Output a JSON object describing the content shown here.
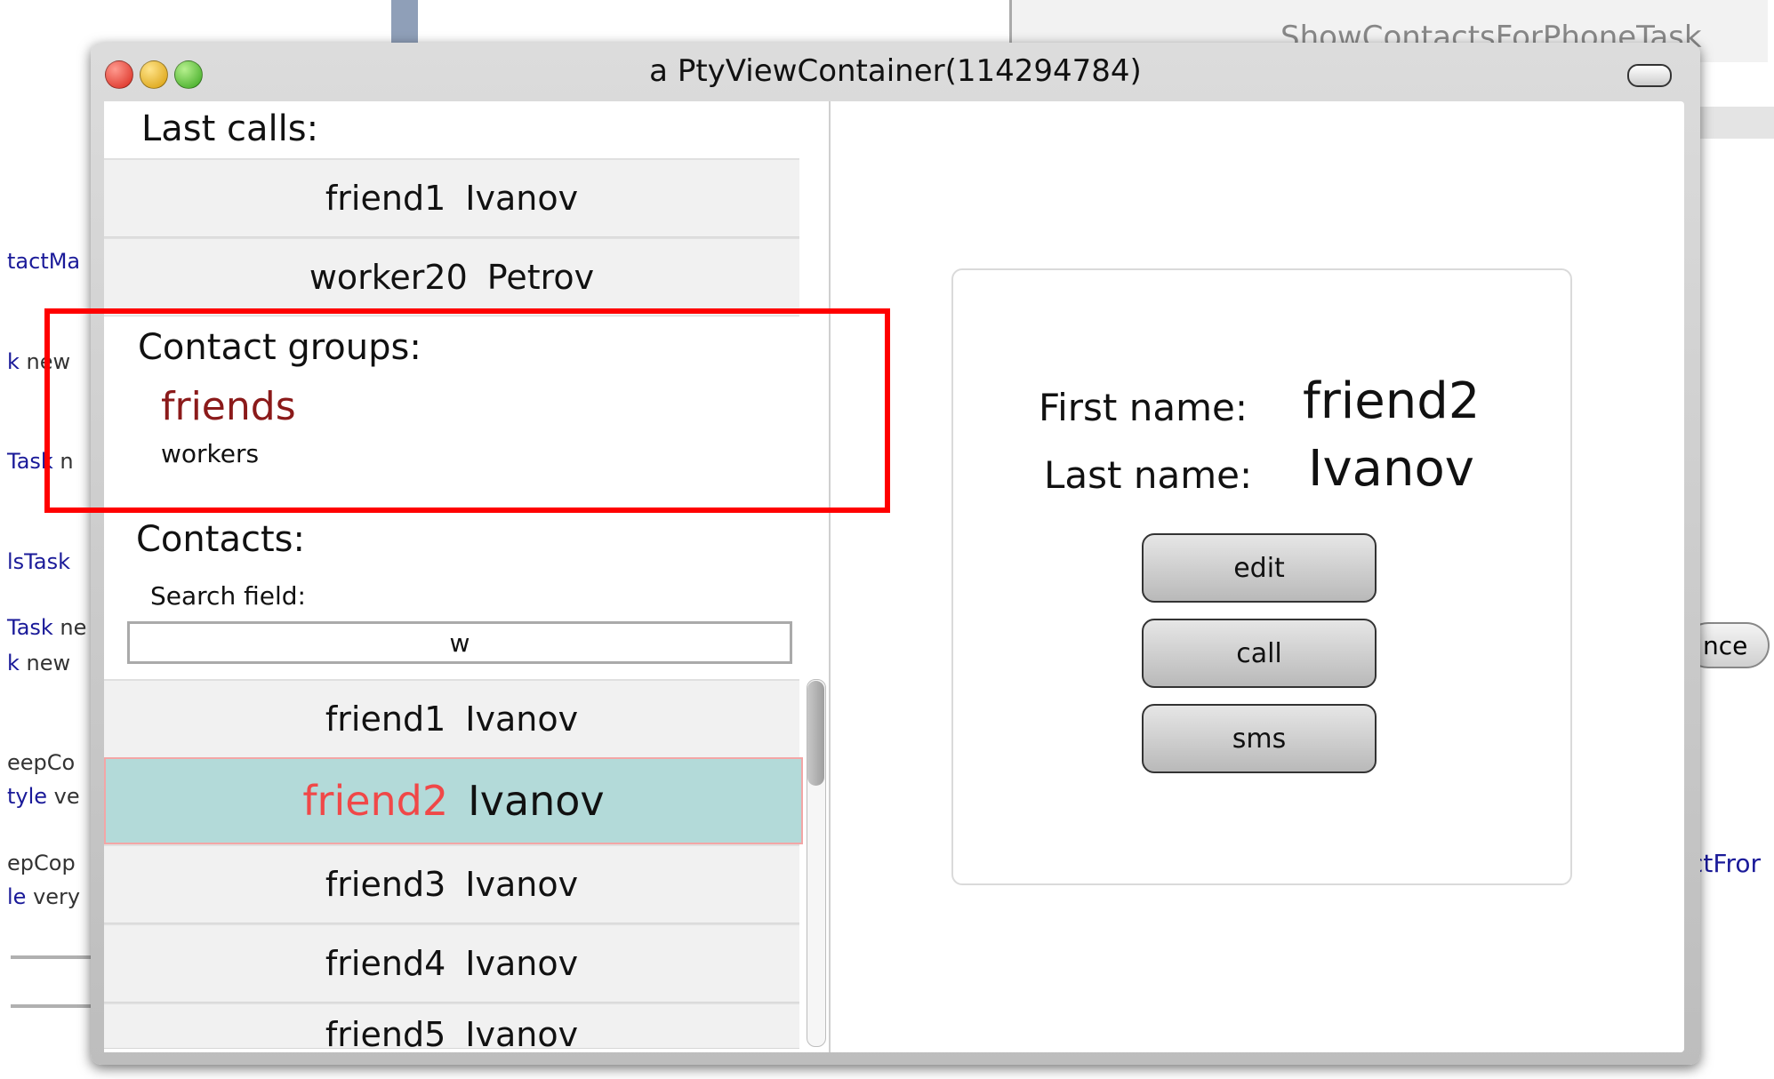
{
  "background": {
    "top_right_title": "ShowContactsForPhoneTask",
    "right_button": "nce",
    "right_text": "ctFror",
    "left_snippets": [
      {
        "a": "tactMa",
        "b": ""
      },
      {
        "a": "k",
        "b": " new"
      },
      {
        "a": "Task",
        "b": " n"
      },
      {
        "a": "lsTask",
        "b": ""
      },
      {
        "a": "Task",
        "b": " ne"
      },
      {
        "a": "k",
        "b": " new"
      },
      {
        "a": "",
        "b": "eepCo"
      },
      {
        "a": "tyle",
        "b": " ve"
      },
      {
        "a": "",
        "b": "epCop"
      },
      {
        "a": "le",
        "b": " very"
      }
    ]
  },
  "window": {
    "title": "a PtyViewContainer(114294784)"
  },
  "left_pane": {
    "last_calls_label": "Last calls:",
    "last_calls": [
      {
        "first": "friend1",
        "last": "Ivanov"
      },
      {
        "first": "worker20",
        "last": "Petrov"
      }
    ],
    "groups_label": "Contact groups:",
    "groups": [
      {
        "name": "friends",
        "selected": true
      },
      {
        "name": "workers",
        "selected": false
      }
    ],
    "contacts_label": "Contacts:",
    "search_label": "Search field:",
    "search_value": "w",
    "contacts": [
      {
        "first": "friend1",
        "last": "Ivanov",
        "selected": false
      },
      {
        "first": "friend2",
        "last": "Ivanov",
        "selected": true
      },
      {
        "first": "friend3",
        "last": "Ivanov",
        "selected": false
      },
      {
        "first": "friend4",
        "last": "Ivanov",
        "selected": false
      },
      {
        "first": "friend5",
        "last": "Ivanov",
        "selected": false
      }
    ]
  },
  "details": {
    "first_name_label": "First name:",
    "first_name": "friend2",
    "last_name_label": "Last name:",
    "last_name": "Ivanov",
    "buttons": [
      "edit",
      "call",
      "sms"
    ]
  },
  "colors": {
    "selected_row_bg": "#b3dad9",
    "selected_name": "#f04848",
    "selected_group": "#8b1a1a",
    "highlight_box": "#ff0000"
  }
}
